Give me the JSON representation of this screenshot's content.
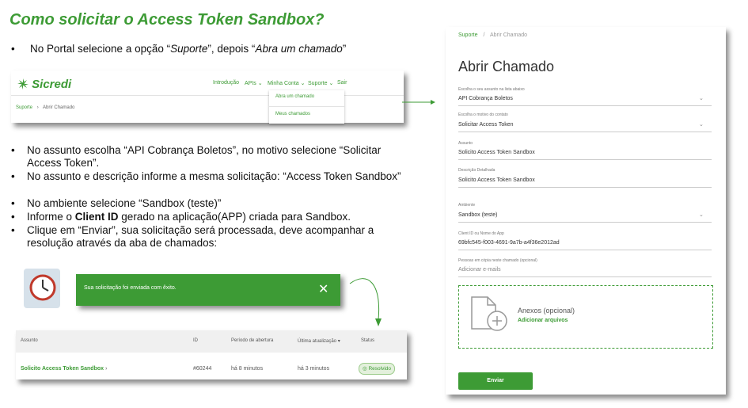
{
  "title": "Como solicitar o Access Token Sandbox?",
  "step1": {
    "prefix": "No Portal selecione a opção “",
    "em1": "Suporte",
    "mid": "”, depois “",
    "em2": "Abra um chamado",
    "suffix": "”"
  },
  "bullets": [
    {
      "text": "No assunto escolha “API Cobrança Boletos”, no motivo selecione “Solicitar Access Token”."
    },
    {
      "text": "No assunto e descrição informe a mesma solicitação: “Access Token Sandbox”"
    },
    {
      "text": "No ambiente selecione “Sandbox (teste)”"
    },
    {
      "prefix": "Informe o ",
      "strong": "Client ID",
      "suffix": " gerado na aplicação(APP) criada para Sandbox."
    },
    {
      "text": "Clique em “Enviar”, sua solicitação será processada, deve acompanhar a resolução através da aba de chamados:"
    }
  ],
  "portal": {
    "logo": "Sicredi",
    "nav": [
      "Introdução",
      "APIs",
      "Minha Conta",
      "Suporte",
      "Sair"
    ],
    "breadcrumb": [
      "Suporte",
      "Abrir Chamado"
    ],
    "dropdown": [
      "Abra um chamado",
      "Meus chamados"
    ]
  },
  "form": {
    "breadcrumb": [
      "Suporte",
      "Abrir Chamado"
    ],
    "heading": "Abrir Chamado",
    "fields": [
      {
        "label": "Escolha o seu assunto na lista abaixo",
        "value": "API Cobrança Boletos",
        "select": true
      },
      {
        "label": "Escolha o motivo do contato",
        "value": "Solicitar Access Token",
        "select": true
      },
      {
        "label": "Assunto",
        "value": "Solicito Access Token Sandbox",
        "select": false
      },
      {
        "label": "Descrição Detalhada",
        "value": "Solicito Access Token Sandbox",
        "select": false
      },
      {
        "label": "Ambiente",
        "value": "Sandbox (teste)",
        "select": true
      },
      {
        "label": "Client ID ou Nome do App",
        "value": "69bfc545-f003-4691-9a7b-a4f36e2012ad",
        "select": false
      },
      {
        "label": "Pessoas em cópia neste chamado (opcional)",
        "value": "Adicionar e-mails",
        "select": false
      }
    ],
    "attach_title": "Anexos (opcional)",
    "attach_link": "Adicionar arquivos",
    "send": "Enviar"
  },
  "toast": {
    "message": "Sua solicitação foi enviada com êxito."
  },
  "table": {
    "headers": [
      "Assunto",
      "ID",
      "Período de abertura",
      "Última atualização ▾",
      "Status"
    ],
    "row": [
      "Solicito Access Token Sandbox",
      "#60244",
      "há 8 minutos",
      "há 3 minutos",
      "Resolvido"
    ]
  },
  "colors": {
    "brand": "#3d9b35"
  }
}
